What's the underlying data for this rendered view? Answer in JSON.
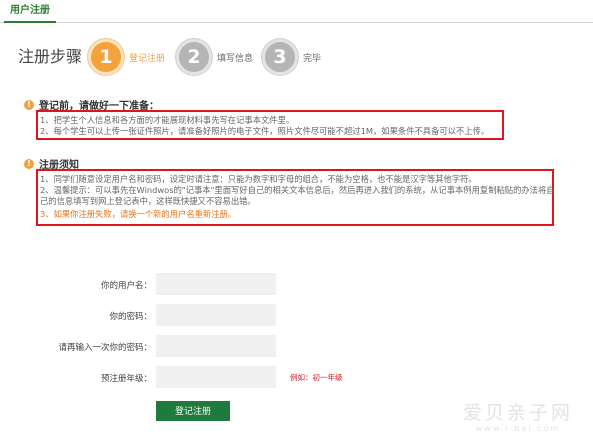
{
  "tab": {
    "label": "用户注册"
  },
  "steps": {
    "title": "注册步骤",
    "items": [
      {
        "number": "1",
        "label": "登记注册",
        "active": true
      },
      {
        "number": "2",
        "label": "填写信息",
        "active": false
      },
      {
        "number": "3",
        "label": "完毕",
        "active": false
      }
    ]
  },
  "prep": {
    "heading": "登记前，请做好一下准备：",
    "lines": [
      "1、把学生个人信息和各方面的才能展现材料事先写在记事本文件里。",
      "2、每个学生可以上传一张证件照片，请准备好照片的电子文件，照片文件尽可能不超过1M，如果条件不具备可以不上传。"
    ]
  },
  "rules": {
    "heading": "注册须知",
    "lines": [
      "1、同学们随意设定用户名和密码，设定时请注意：只能为数字和字母的组合，不能为空格，也不能是汉字等其他字符。",
      "2、温馨提示：可以事先在Windwos的\"记事本\"里面写好自己的相关文本信息后，然后再进入我们的系统，从记事本例用复制粘贴的办法将自",
      "己的信息填写到网上登记表中，这样既快捷又不容易出错。",
      "3、如果你注册失败，请换一个新的用户名重新注册。"
    ]
  },
  "form": {
    "username_label": "你的用户名：",
    "password_label": "你的密码：",
    "confirm_label": "请再输入一次你的密码：",
    "grade_label": "预注册年级：",
    "grade_hint": "例如：初一年级",
    "username_value": "",
    "password_value": "",
    "confirm_value": "",
    "grade_value": ""
  },
  "submit": {
    "label": "登记注册"
  },
  "watermark": {
    "main": "爱贝亲子网",
    "sub": "www.i-bei.com"
  },
  "colors": {
    "accent_green": "#1f7a3e",
    "step_active": "#f4a23c",
    "step_inactive": "#b5b5b5",
    "highlight_red": "#e0141e",
    "note_orange": "#e8751a"
  }
}
